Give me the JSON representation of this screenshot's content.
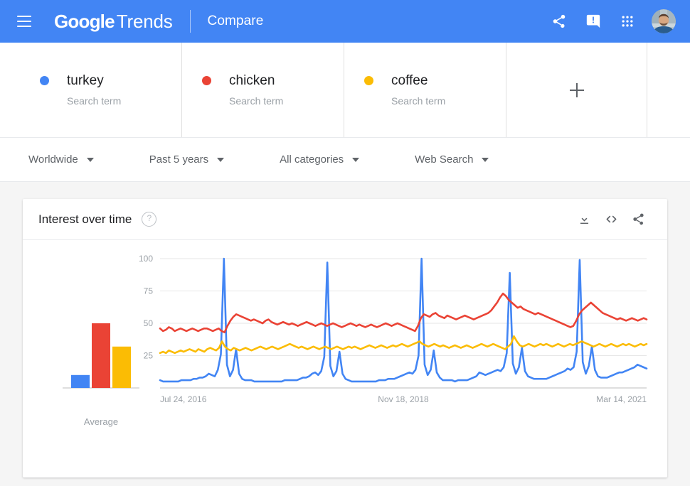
{
  "header": {
    "menu_icon": "hamburger-menu-icon",
    "brand_primary": "Google",
    "brand_secondary": "Trends",
    "page_mode": "Compare",
    "icons": [
      {
        "name": "share-icon",
        "label": "Share"
      },
      {
        "name": "feedback-icon",
        "label": "Send feedback"
      },
      {
        "name": "apps-grid-icon",
        "label": "Google apps"
      }
    ],
    "avatar_label": "Google Account"
  },
  "compare": {
    "terms": [
      {
        "label": "turkey",
        "type": "Search term",
        "color": "#4285f4"
      },
      {
        "label": "chicken",
        "type": "Search term",
        "color": "#ea4335"
      },
      {
        "label": "coffee",
        "type": "Search term",
        "color": "#fbbc04"
      }
    ],
    "add_label": "+"
  },
  "filters": [
    {
      "name": "location",
      "value": "Worldwide"
    },
    {
      "name": "time-range",
      "value": "Past 5 years"
    },
    {
      "name": "category",
      "value": "All categories"
    },
    {
      "name": "search-type",
      "value": "Web Search"
    }
  ],
  "card": {
    "title": "Interest over time",
    "help": "?",
    "actions": [
      {
        "name": "download-csv-icon",
        "label": "Download"
      },
      {
        "name": "embed-code-icon",
        "label": "Embed"
      },
      {
        "name": "share-icon",
        "label": "Share"
      }
    ]
  },
  "chart_data": {
    "type": "line",
    "title": "Interest over time",
    "xlabel": "",
    "ylabel": "",
    "ylim": [
      0,
      100
    ],
    "yticks": [
      25,
      50,
      75,
      100
    ],
    "ytick_labels": [
      "25",
      "50",
      "75",
      "100"
    ],
    "grid": true,
    "legend_position": "top-cards",
    "xtick_labels": [
      "Jul 24, 2016",
      "Nov 18, 2018",
      "Mar 14, 2021"
    ],
    "xtick_positions": [
      0,
      0.5,
      1.0
    ],
    "x_start": "Jul 24, 2016",
    "x_end": "Mar 14, 2021",
    "average_panel": {
      "label": "Average",
      "categories": [
        "turkey",
        "chicken",
        "coffee"
      ],
      "values": [
        10,
        50,
        32
      ],
      "colors": [
        "#4285f4",
        "#ea4335",
        "#fbbc04"
      ]
    },
    "series": [
      {
        "name": "turkey",
        "color": "#4285f4",
        "values": [
          6,
          5,
          5,
          5,
          5,
          5,
          5,
          6,
          6,
          6,
          6,
          7,
          7,
          8,
          8,
          9,
          11,
          10,
          9,
          14,
          26,
          100,
          18,
          9,
          14,
          30,
          11,
          7,
          6,
          6,
          6,
          5,
          5,
          5,
          5,
          5,
          5,
          5,
          5,
          5,
          5,
          6,
          6,
          6,
          6,
          6,
          7,
          8,
          8,
          9,
          11,
          12,
          10,
          13,
          24,
          97,
          17,
          9,
          13,
          28,
          11,
          7,
          6,
          5,
          5,
          5,
          5,
          5,
          5,
          5,
          5,
          5,
          6,
          6,
          6,
          7,
          7,
          7,
          8,
          9,
          10,
          11,
          12,
          11,
          14,
          25,
          100,
          18,
          10,
          14,
          29,
          12,
          8,
          6,
          6,
          6,
          6,
          5,
          6,
          6,
          6,
          6,
          7,
          8,
          9,
          12,
          11,
          10,
          11,
          12,
          13,
          14,
          13,
          16,
          27,
          89,
          19,
          11,
          16,
          31,
          13,
          9,
          8,
          7,
          7,
          7,
          7,
          7,
          8,
          9,
          10,
          11,
          12,
          13,
          15,
          14,
          16,
          28,
          99,
          20,
          11,
          17,
          32,
          14,
          9,
          8,
          8,
          8,
          9,
          10,
          11,
          12,
          12,
          13,
          14,
          15,
          16,
          18,
          17,
          16,
          15
        ]
      },
      {
        "name": "chicken",
        "color": "#ea4335",
        "values": [
          46,
          44,
          45,
          47,
          46,
          44,
          45,
          46,
          45,
          44,
          45,
          46,
          45,
          44,
          45,
          46,
          46,
          45,
          44,
          45,
          46,
          44,
          43,
          48,
          52,
          55,
          57,
          56,
          55,
          54,
          53,
          52,
          53,
          52,
          51,
          50,
          52,
          53,
          51,
          50,
          49,
          50,
          51,
          50,
          49,
          50,
          49,
          48,
          49,
          50,
          51,
          50,
          49,
          48,
          49,
          50,
          49,
          48,
          49,
          50,
          49,
          48,
          47,
          48,
          49,
          50,
          49,
          48,
          49,
          48,
          47,
          48,
          49,
          48,
          47,
          48,
          49,
          50,
          49,
          48,
          49,
          50,
          49,
          48,
          47,
          46,
          45,
          44,
          48,
          54,
          57,
          56,
          55,
          57,
          58,
          56,
          55,
          54,
          56,
          55,
          54,
          53,
          54,
          55,
          56,
          55,
          54,
          53,
          54,
          55,
          56,
          57,
          58,
          60,
          63,
          66,
          70,
          73,
          71,
          68,
          66,
          64,
          62,
          63,
          61,
          60,
          59,
          58,
          57,
          58,
          57,
          56,
          55,
          54,
          53,
          52,
          51,
          50,
          49,
          48,
          47,
          48,
          52,
          57,
          60,
          62,
          64,
          66,
          64,
          62,
          60,
          58,
          57,
          56,
          55,
          54,
          53,
          54,
          53,
          52,
          53,
          54,
          53,
          52,
          53,
          54,
          53
        ]
      },
      {
        "name": "coffee",
        "color": "#fbbc04",
        "values": [
          27,
          28,
          27,
          29,
          28,
          27,
          28,
          29,
          28,
          29,
          30,
          29,
          28,
          30,
          29,
          28,
          30,
          31,
          30,
          29,
          31,
          36,
          32,
          30,
          29,
          31,
          30,
          29,
          30,
          31,
          30,
          29,
          30,
          31,
          32,
          31,
          30,
          31,
          32,
          31,
          30,
          31,
          32,
          33,
          34,
          33,
          32,
          31,
          32,
          31,
          30,
          31,
          32,
          31,
          30,
          31,
          32,
          31,
          30,
          31,
          32,
          31,
          30,
          31,
          32,
          31,
          32,
          31,
          30,
          31,
          32,
          33,
          32,
          31,
          32,
          33,
          32,
          31,
          32,
          33,
          32,
          33,
          34,
          33,
          32,
          33,
          34,
          35,
          36,
          34,
          33,
          32,
          33,
          34,
          33,
          32,
          33,
          32,
          31,
          32,
          33,
          32,
          31,
          32,
          33,
          32,
          31,
          32,
          33,
          34,
          33,
          32,
          33,
          34,
          33,
          32,
          31,
          30,
          32,
          34,
          40,
          36,
          33,
          32,
          33,
          34,
          33,
          32,
          33,
          34,
          33,
          34,
          33,
          32,
          33,
          34,
          33,
          32,
          33,
          34,
          33,
          34,
          35,
          36,
          35,
          34,
          33,
          32,
          33,
          34,
          33,
          32,
          33,
          34,
          33,
          32,
          33,
          34,
          33,
          34,
          33,
          32,
          33,
          34,
          33,
          34
        ]
      }
    ]
  }
}
